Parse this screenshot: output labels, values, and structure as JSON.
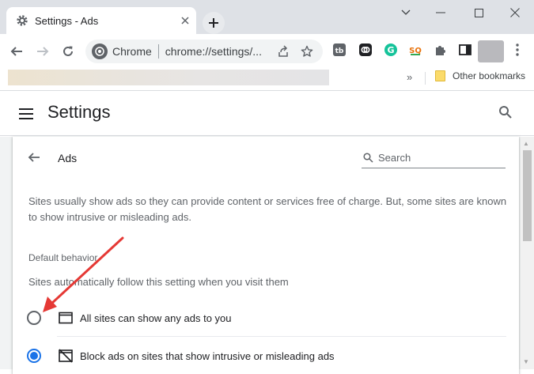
{
  "tab": {
    "title": "Settings - Ads"
  },
  "omnibox": {
    "site_chip": "Chrome",
    "url": "chrome://settings/..."
  },
  "bookmarks": {
    "other_label": "Other bookmarks",
    "overflow": "»"
  },
  "header": {
    "title": "Settings"
  },
  "page": {
    "title": "Ads",
    "search_placeholder": "Search",
    "description": "Sites usually show ads so they can provide content or services free of charge. But, some sites are known to show intrusive or misleading ads.",
    "section_heading": "Default behavior",
    "section_sub": "Sites automatically follow this setting when you visit them",
    "options": [
      {
        "label": "All sites can show any ads to you",
        "checked": false,
        "icon": "window-icon"
      },
      {
        "label": "Block ads on sites that show intrusive or misleading ads",
        "checked": true,
        "icon": "ads-blocked-icon"
      }
    ]
  },
  "colors": {
    "accent": "#1a73e8",
    "annotation_arrow": "#e53935"
  }
}
